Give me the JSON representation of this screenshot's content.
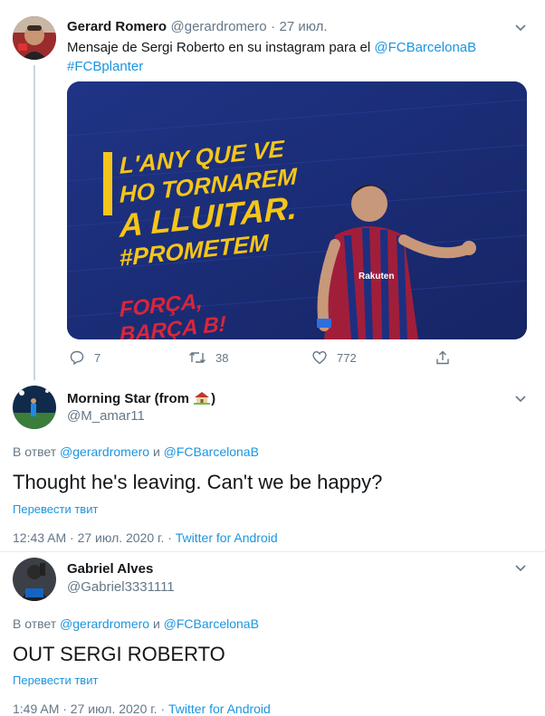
{
  "tweet1": {
    "name": "Gerard Romero",
    "handle": "@gerardromero",
    "sep": "·",
    "date": "27 июл.",
    "text_prefix": "Mensaje de Sergi Roberto en su instagram para el ",
    "mention": "@FCBarcelonaB",
    "hashtag": "#FCBplanter",
    "image": {
      "line1": "L'ANY QUE VE",
      "line2": "HO TORNAREM",
      "line3": "A LLUITAR.",
      "line4": "#PROMETEM",
      "line5": "FORÇA,",
      "line6": "BARÇA B!",
      "shirt_brand": "Rakuten"
    },
    "replies": "7",
    "retweets": "38",
    "likes": "772"
  },
  "reply1": {
    "name": "Morning Star (from ",
    "name_end": ")",
    "handle": "@M_amar11",
    "reply_to_label": "В ответ",
    "mention1": "@gerardromero",
    "and": "и",
    "mention2": "@FCBarcelonaB",
    "text": "Thought he's leaving. Can't we be happy?",
    "translate": "Перевести твит",
    "time": "12:43 AM · 27 июл. 2020 г. ·",
    "source": "Twitter for Android"
  },
  "reply2": {
    "name": "Gabriel Alves",
    "handle": "@Gabriel3331111",
    "reply_to_label": "В ответ",
    "mention1": "@gerardromero",
    "and": "и",
    "mention2": "@FCBarcelonaB",
    "text": "OUT SERGI ROBERTO",
    "translate": "Перевести твит",
    "time": "1:49 AM · 27 июл. 2020 г. ·",
    "source": "Twitter for Android"
  },
  "colors": {
    "link": "#1b95e0",
    "secondary": "#657786",
    "poster_yellow": "#f5c518",
    "poster_red": "#d8263b",
    "poster_bg": "#1b2d7a"
  }
}
